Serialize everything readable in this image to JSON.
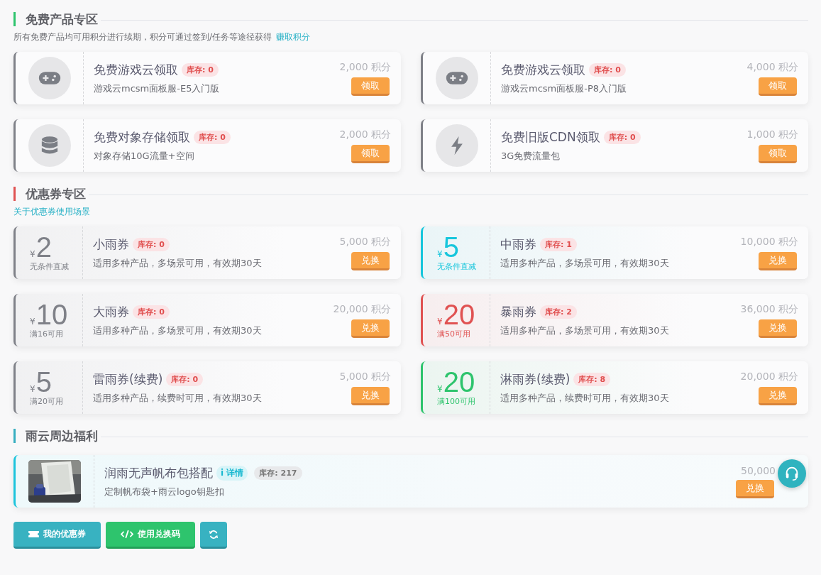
{
  "free_section": {
    "title": "免费产品专区",
    "description": "所有免费产品均可用积分进行续期，积分可通过签到/任务等途径获得",
    "link": "赚取积分",
    "items": [
      {
        "kind": "gamepad",
        "name": "免费游戏云领取",
        "stock": "库存: 0",
        "subtitle": "游戏云mcsm面板服-E5入门版",
        "price": "2,000 积分",
        "button": "领取"
      },
      {
        "kind": "gamepad",
        "name": "免费游戏云领取",
        "stock": "库存: 0",
        "subtitle": "游戏云mcsm面板服-P8入门版",
        "price": "4,000 积分",
        "button": "领取"
      },
      {
        "kind": "storage",
        "name": "免费对象存储领取",
        "stock": "库存: 0",
        "subtitle": "对象存储10G流量+空间",
        "price": "2,000 积分",
        "button": "领取"
      },
      {
        "kind": "cdn",
        "name": "免费旧版CDN领取",
        "stock": "库存: 0",
        "subtitle": "3G免费流量包",
        "price": "1,000 积分",
        "button": "领取"
      }
    ]
  },
  "coupon_section": {
    "title": "优惠券专区",
    "link": "关于优惠券使用场景",
    "items": [
      {
        "currency": "¥",
        "amount": "2",
        "condition": "无条件直减",
        "color": "#7f8188",
        "name": "小雨券",
        "stock": "库存: 0",
        "subtitle": "适用多种产品，多场景可用，有效期30天",
        "price": "5,000 积分",
        "button": "兑换"
      },
      {
        "currency": "¥",
        "amount": "5",
        "condition": "无条件直减",
        "color": "#17c6dc",
        "name": "中雨券",
        "stock": "库存: 1",
        "subtitle": "适用多种产品，多场景可用，有效期30天",
        "price": "10,000 积分",
        "button": "兑换"
      },
      {
        "currency": "¥",
        "amount": "10",
        "condition": "满16可用",
        "color": "#7f8188",
        "name": "大雨券",
        "stock": "库存: 0",
        "subtitle": "适用多种产品，多场景可用，有效期30天",
        "price": "20,000 积分",
        "button": "兑换"
      },
      {
        "currency": "¥",
        "amount": "20",
        "condition": "满50可用",
        "color": "#e05252",
        "name": "暴雨券",
        "stock": "库存: 2",
        "subtitle": "适用多种产品，多场景可用，有效期30天",
        "price": "36,000 积分",
        "button": "兑换"
      },
      {
        "currency": "¥",
        "amount": "5",
        "condition": "满20可用",
        "color": "#7f8188",
        "name": "雷雨券(续费)",
        "stock": "库存: 0",
        "subtitle": "适用多种产品，续费时可用，有效期30天",
        "price": "5,000 积分",
        "button": "兑换"
      },
      {
        "currency": "¥",
        "amount": "20",
        "condition": "满100可用",
        "color": "#2ec46d",
        "name": "淋雨券(续费)",
        "stock": "库存: 8",
        "subtitle": "适用多种产品，续费时可用，有效期30天",
        "price": "20,000 积分",
        "button": "兑换"
      }
    ]
  },
  "merch_section": {
    "title": "雨云周边福利",
    "items": [
      {
        "name": "润雨无声帆布包搭配",
        "details": "i 详情",
        "stock": "库存: 217",
        "subtitle": "定制帆布袋+雨云logo钥匙扣",
        "price": "50,000",
        "button": "兑换"
      }
    ]
  },
  "actions": [
    {
      "kind": "coupons",
      "label": "我的优惠券"
    },
    {
      "kind": "code",
      "label": "使用兑换码"
    },
    {
      "kind": "refresh"
    }
  ]
}
